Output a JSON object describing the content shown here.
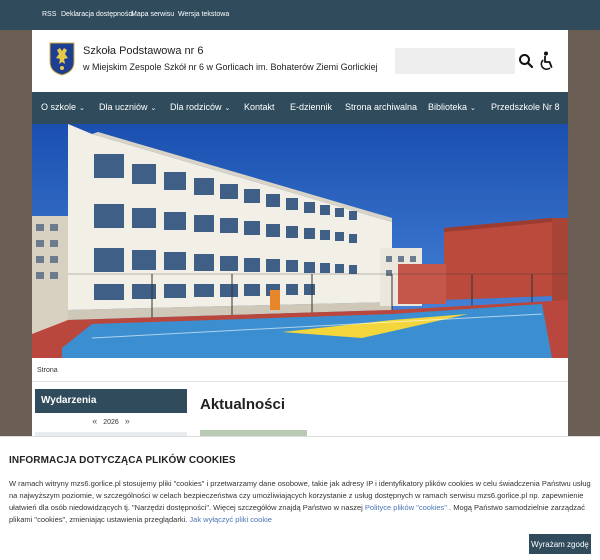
{
  "topbar": {
    "links": [
      "RSS",
      "Deklaracja dostępności",
      "Mapa serwisu",
      "Wersja tekstowa"
    ]
  },
  "header": {
    "school_name": "Szkoła Podstawowa nr 6",
    "school_subtitle": "w Miejskim Zespole Szkół nr 6 w Gorlicach im. Bohaterów Ziemi Gorlickiej",
    "search_value": ""
  },
  "nav": {
    "items": [
      {
        "label": "O szkole",
        "caret": "⌄"
      },
      {
        "label": "Dla uczniów",
        "caret": "⌄"
      },
      {
        "label": "Dla rodziców",
        "caret": "⌄"
      },
      {
        "label": "Kontakt",
        "caret": ""
      },
      {
        "label": "E-dziennik",
        "caret": ""
      },
      {
        "label": "Strona archiwalna",
        "caret": ""
      },
      {
        "label": "Biblioteka",
        "caret": "⌄"
      },
      {
        "label": "Przedszkole Nr 8",
        "caret": ""
      }
    ]
  },
  "breadcrumb": "Strona",
  "sidebar": {
    "events_title": "Wydarzenia",
    "prev": "«",
    "year": "2026",
    "next": "»"
  },
  "main": {
    "news_title": "Aktualności"
  },
  "cookie": {
    "title": "INFORMACJA DOTYCZĄCA PLIKÓW COOKIES",
    "text_1": "W ramach witryny mzs6.gorlice.pl stosujemy pliki \"cookies\" i przetwarzamy dane osobowe, takie jak adresy IP i identyfikatory plików cookies w celu świadczenia Państwu usług na najwyższym poziomie, w szczególności w celach bezpieczeństwa czy umożliwiających korzystanie z usług dostępnych w ramach serwisu mzs6.gorlice.pl np. zapewnienie ułatwień dla osób niedowidzących tj. \"Narzędzi dostępności\". Więcej szczegółów znajdą Państwo w naszej ",
    "link_1": "Polityce plików \"cookies\"",
    "text_2": " . Mogą Państwo samodzielnie zarządzać plikami \"cookies\", zmieniając ustawienia przeglądarki. ",
    "link_2": "Jak wyłączyć pliki cookie",
    "accept": "Wyrażam zgodę"
  },
  "colors": {
    "nav_bg": "#2f4b5c",
    "outer_bg": "#6b5e55",
    "link": "#4a76b5"
  },
  "icons": [
    "search-icon",
    "accessibility-icon",
    "logo-coat-of-arms"
  ]
}
